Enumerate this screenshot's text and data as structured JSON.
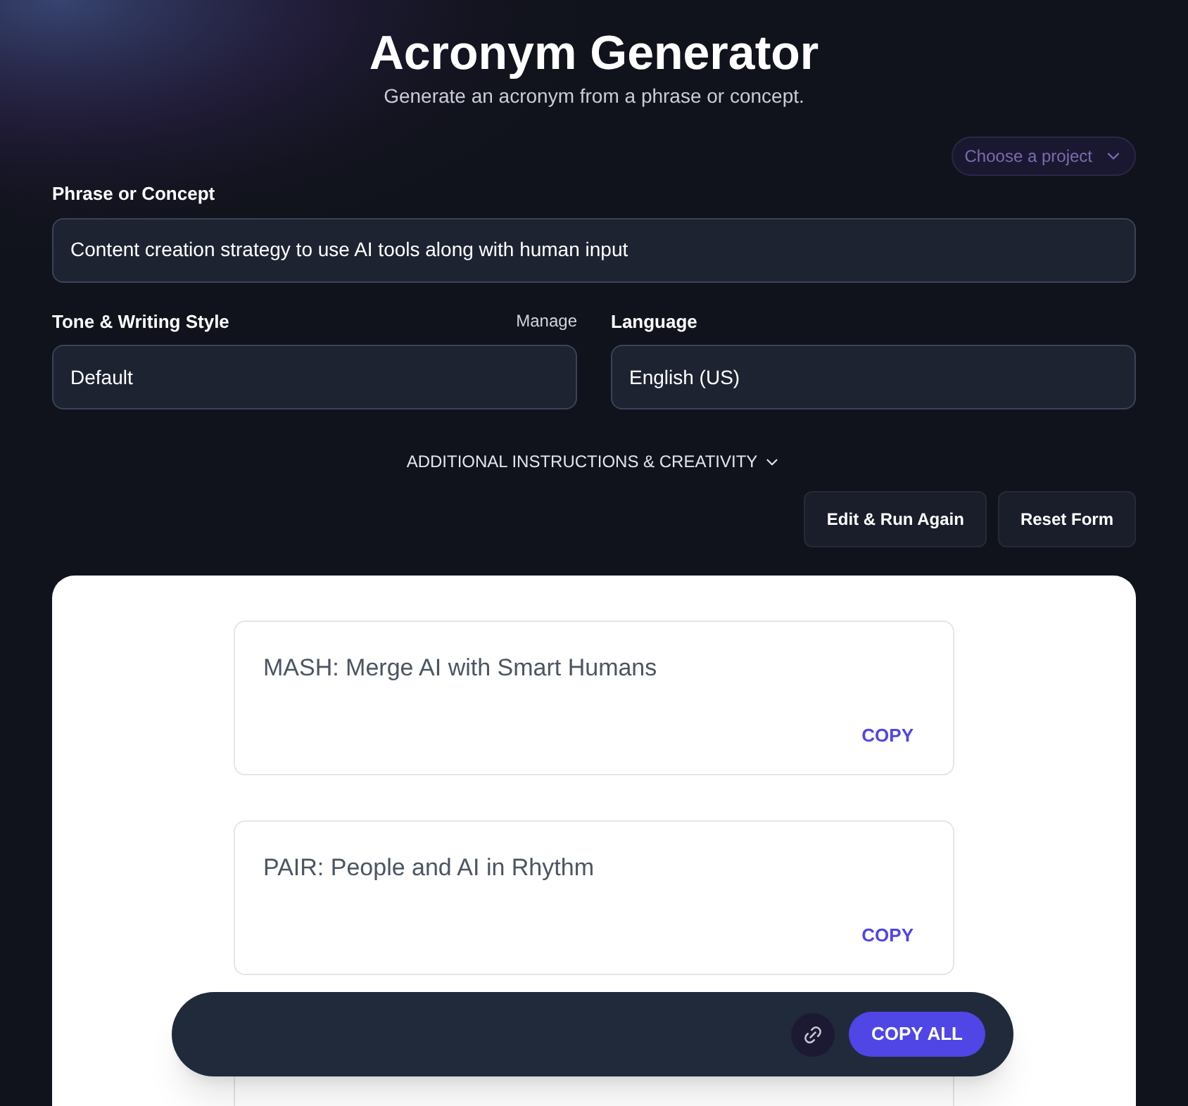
{
  "header": {
    "title": "Acronym Generator",
    "subtitle": "Generate an acronym from a phrase or concept."
  },
  "project_select": {
    "label": "Choose a project"
  },
  "phrase": {
    "label": "Phrase or Concept",
    "value": "Content creation strategy to use AI tools along with human input"
  },
  "tone": {
    "label": "Tone & Writing Style",
    "manage": "Manage",
    "value": "Default"
  },
  "language": {
    "label": "Language",
    "value": "English (US)"
  },
  "additional": {
    "label": "ADDITIONAL INSTRUCTIONS & CREATIVITY",
    "expanded": false
  },
  "buttons": [
    "Edit & Run Again",
    "Reset Form"
  ],
  "results": [
    {
      "kind": "result",
      "text": "MASH: Merge AI with Smart Humans",
      "copy": "COPY"
    },
    {
      "kind": "result",
      "text": "PAIR: People and AI in Rhythm",
      "copy": "COPY"
    },
    {
      "kind": "covered"
    }
  ],
  "action_bar": {
    "copy_all": "COPY ALL"
  }
}
